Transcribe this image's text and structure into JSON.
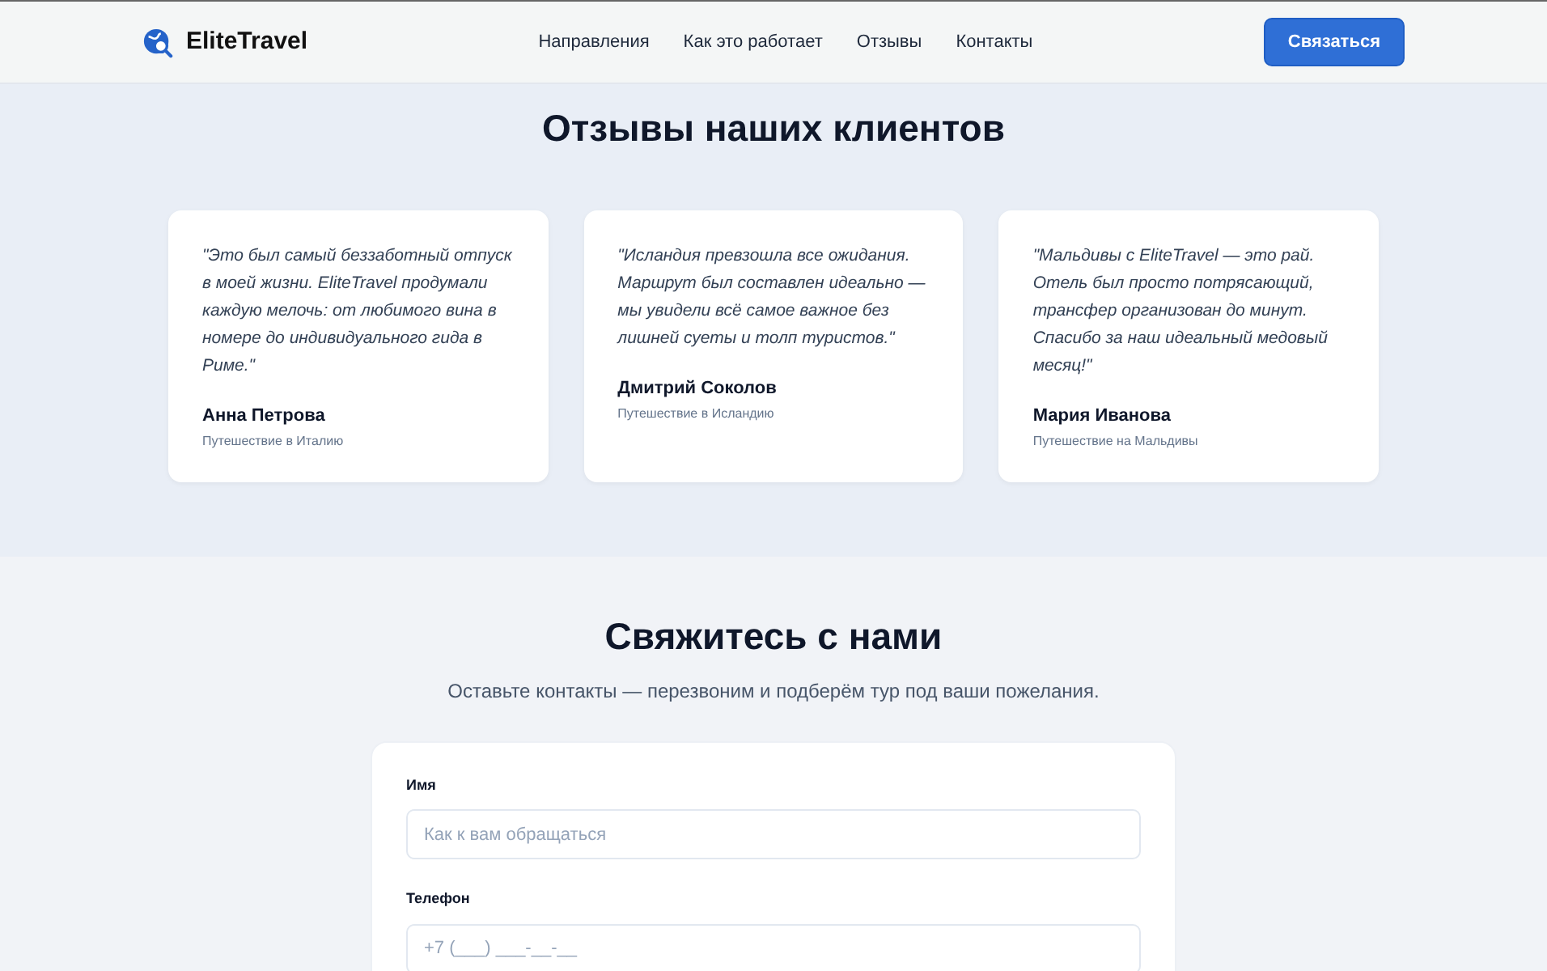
{
  "navbar": {
    "brand": "EliteTravel",
    "links": [
      "Направления",
      "Как это работает",
      "Отзывы",
      "Контакты"
    ],
    "cta": "Связаться"
  },
  "testimonials": {
    "title": "Отзывы наших клиентов",
    "items": [
      {
        "quote": "\"Это был самый беззаботный отпуск в моей жизни. EliteTravel продумали каждую мелочь: от любимого вина в номере до индивидуального гида в Риме.\"",
        "name": "Анна Петрова",
        "trip": "Путешествие в Италию"
      },
      {
        "quote": "\"Исландия превзошла все ожидания. Маршрут был составлен идеально — мы увидели всё самое важное без лишней суеты и толп туристов.\"",
        "name": "Дмитрий Соколов",
        "trip": "Путешествие в Исландию"
      },
      {
        "quote": "\"Мальдивы с EliteTravel — это рай. Отель был просто потрясающий, трансфер организован до минут. Спасибо за наш идеальный медовый месяц!\"",
        "name": "Мария Иванова",
        "trip": "Путешествие на Мальдивы"
      }
    ]
  },
  "contact": {
    "title": "Свяжитесь с нами",
    "subtitle": "Оставьте контакты — перезвоним и подберём тур под ваши пожелания.",
    "fields": [
      {
        "label": "Имя",
        "placeholder": "Как к вам обращаться"
      },
      {
        "label": "Телефон",
        "placeholder": "+7 (___) ___-__-__"
      }
    ]
  }
}
